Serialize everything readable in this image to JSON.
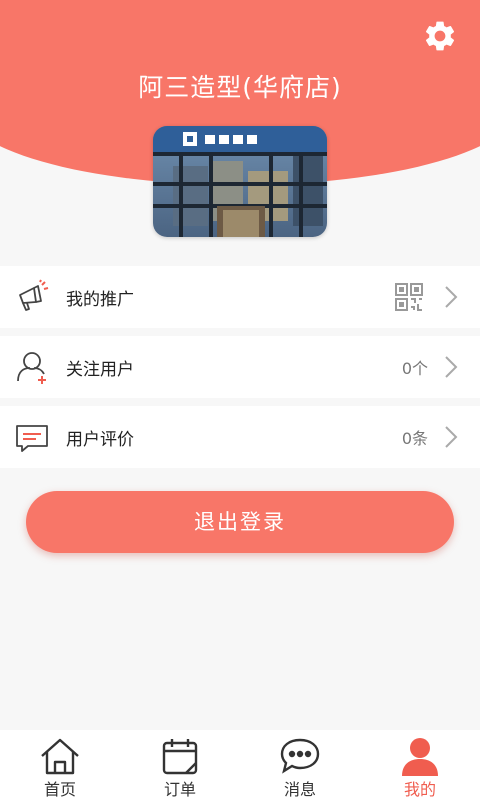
{
  "header": {
    "store_name": "阿三造型(华府店)",
    "store_photo_sign": "阿三造型"
  },
  "menu": [
    {
      "label": "我的推广",
      "value": ""
    },
    {
      "label": "关注用户",
      "value": "0个"
    },
    {
      "label": "用户评价",
      "value": "0条"
    }
  ],
  "logout_label": "退出登录",
  "tabs": [
    {
      "label": "首页",
      "icon": "home-icon",
      "active": false
    },
    {
      "label": "订单",
      "icon": "calendar-icon",
      "active": false
    },
    {
      "label": "消息",
      "icon": "chat-bubble-icon",
      "active": false
    },
    {
      "label": "我的",
      "icon": "person-icon",
      "active": true
    }
  ],
  "colors": {
    "accent": "#f87668",
    "active_tab": "#f05d4f"
  }
}
